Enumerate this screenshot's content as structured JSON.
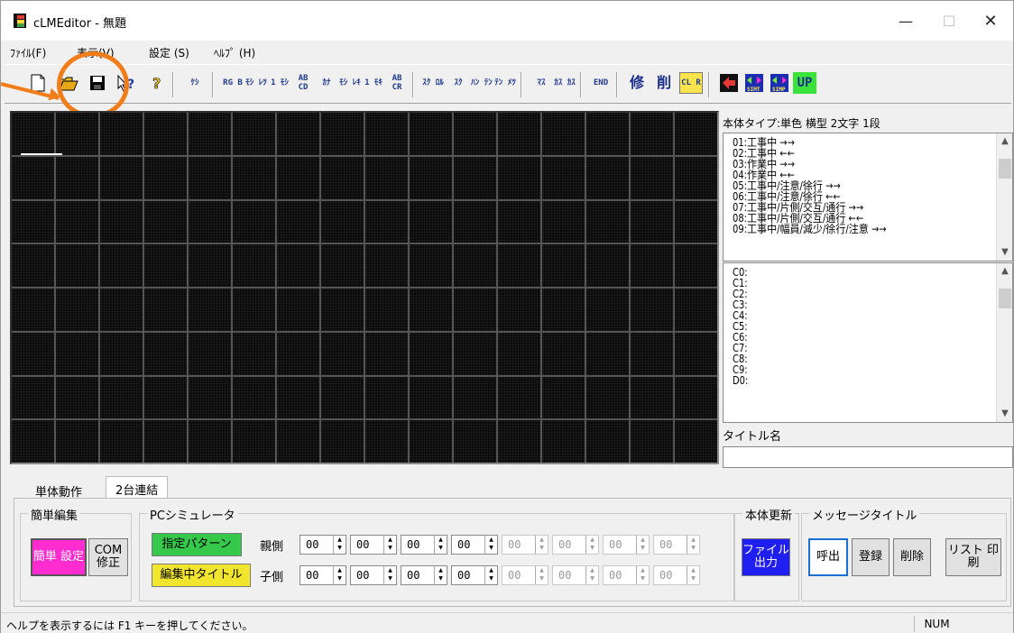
{
  "window": {
    "title": "cLMEditor - 無題",
    "minimize": "—",
    "maximize": "☐",
    "close": "✕"
  },
  "menu": [
    "ﾌｧｲﾙ(F)",
    "表示(V)",
    "設定 (S)",
    "ﾍﾙﾌﾟ (H)"
  ],
  "toolbar": {
    "buttons": [
      "ｹｼ",
      "RG B",
      "ﾓｼ ﾚﾂ",
      "1 ﾓｼ",
      "AB CD",
      "ｶﾅ",
      "ﾓｼ ﾚｷ",
      "1 ﾓｷ",
      "AB CR",
      "ｽｸ ﾛﾙ",
      "ｽｸ",
      "ﾊﾝ ﾃﾝ",
      "ﾃﾝ ﾒﾂ",
      "ﾏｽ",
      "ｶｽ ｶｽ",
      "END",
      "修",
      "削",
      "CL R",
      "UP"
    ]
  },
  "side": {
    "body_type": "本体タイプ:単色 横型 2文字 1段",
    "patterns": [
      "01:工事中 →→",
      "02:工事中 ←←",
      "03:作業中 →→",
      "04:作業中 ←←",
      "05:工事中/注意/徐行 →→",
      "06:工事中/注意/徐行 ←←",
      "07:工事中/片側/交互/通行 →→",
      "08:工事中/片側/交互/通行 ←←",
      "09:工事中/幅員/減少/徐行/注意 →→"
    ],
    "chars": [
      "C0:",
      "C1:",
      "C2:",
      "C3:",
      "C4:",
      "C5:",
      "C6:",
      "C7:",
      "C8:",
      "C9:",
      "D0:"
    ],
    "title_name_label": "タイトル名",
    "title_name_value": ""
  },
  "tabs": [
    "単体動作",
    "2台連結"
  ],
  "groups": {
    "simple_edit": "簡単編集",
    "pc_sim": "PCシミュレータ",
    "body_update": "本体更新",
    "msg_title": "メッセージタイトル"
  },
  "buttons": {
    "easy_setup": "簡単 設定",
    "com_fix": "COM 修正",
    "designated_pattern": "指定パターン",
    "editing_title": "編集中タイトル",
    "file_output": "ファイル 出力",
    "call": "呼出",
    "register": "登録",
    "delete": "削除",
    "list_print": "リスト 印刷"
  },
  "sim": {
    "parent_label": "親側",
    "child_label": "子側",
    "parent_values": [
      "00",
      "00",
      "00",
      "00",
      "00",
      "00",
      "00",
      "00"
    ],
    "child_values": [
      "00",
      "00",
      "00",
      "00",
      "00",
      "00",
      "00",
      "00"
    ]
  },
  "status": {
    "help": "ヘルプを表示するには F1 キーを押してください。",
    "num": "NUM"
  }
}
